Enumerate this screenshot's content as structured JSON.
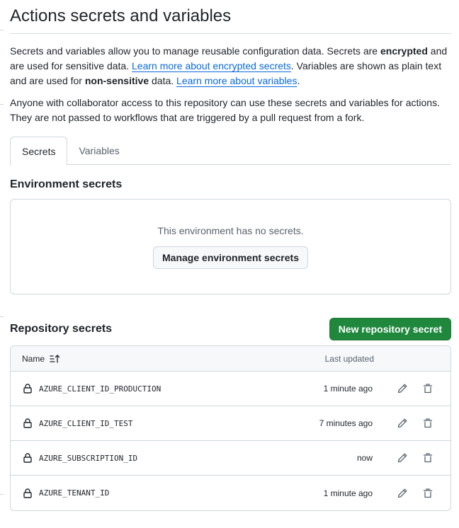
{
  "page": {
    "title": "Actions secrets and variables"
  },
  "description": {
    "p1_part1": "Secrets and variables allow you to manage reusable configuration data. Secrets are ",
    "p1_bold1": "encrypted",
    "p1_part2": " and are used for sensitive data. ",
    "p1_link1": "Learn more about encrypted secrets",
    "p1_part3": ". Variables are shown as plain text and are used for ",
    "p1_bold2": "non-sensitive",
    "p1_part4": " data. ",
    "p1_link2": "Learn more about variables",
    "p1_part5": ".",
    "p2": "Anyone with collaborator access to this repository can use these secrets and variables for actions. They are not passed to workflows that are triggered by a pull request from a fork."
  },
  "tabs": [
    {
      "label": "Secrets",
      "active": true
    },
    {
      "label": "Variables",
      "active": false
    }
  ],
  "environment_secrets": {
    "title": "Environment secrets",
    "empty_message": "This environment has no secrets.",
    "manage_button": "Manage environment secrets"
  },
  "repository_secrets": {
    "title": "Repository secrets",
    "new_button": "New repository secret",
    "columns": {
      "name": "Name",
      "last_updated": "Last updated"
    },
    "rows": [
      {
        "name": "AZURE_CLIENT_ID_PRODUCTION",
        "updated": "1 minute ago"
      },
      {
        "name": "AZURE_CLIENT_ID_TEST",
        "updated": "7 minutes ago"
      },
      {
        "name": "AZURE_SUBSCRIPTION_ID",
        "updated": "now"
      },
      {
        "name": "AZURE_TENANT_ID",
        "updated": "1 minute ago"
      }
    ]
  },
  "icons": {
    "lock": "lock-icon",
    "edit": "pencil-icon",
    "delete": "trash-icon",
    "sort": "sort-asc-icon"
  },
  "colors": {
    "primary_button": "#1f883d",
    "link": "#0969da",
    "border": "#d0d7de"
  }
}
